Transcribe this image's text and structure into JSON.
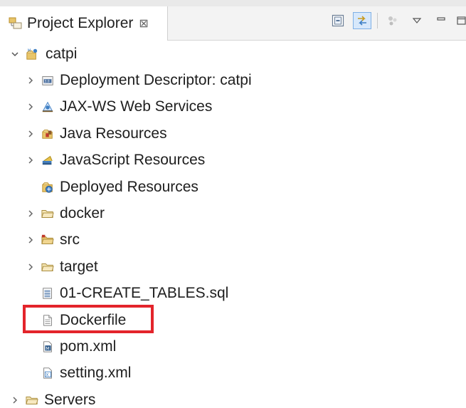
{
  "view": {
    "title": "Project Explorer",
    "close_glyph": "⊠"
  },
  "toolbar": {
    "buttons": [
      {
        "name": "collapse-all-icon"
      },
      {
        "name": "link-with-editor-icon"
      },
      {
        "name": "focus-icon"
      },
      {
        "name": "view-menu-icon"
      },
      {
        "name": "minimize-icon"
      },
      {
        "name": "maximize-icon"
      }
    ]
  },
  "tree": {
    "items": [
      {
        "label": "catpi",
        "icon": "web-project-icon",
        "expanded": true
      },
      {
        "label": "Deployment Descriptor: catpi",
        "icon": "deployment-descriptor-icon"
      },
      {
        "label": "JAX-WS Web Services",
        "icon": "web-services-icon"
      },
      {
        "label": "Java Resources",
        "icon": "java-resources-icon"
      },
      {
        "label": "JavaScript Resources",
        "icon": "javascript-resources-icon"
      },
      {
        "label": "Deployed Resources",
        "icon": "deployed-resources-icon"
      },
      {
        "label": "docker",
        "icon": "folder-icon"
      },
      {
        "label": "src",
        "icon": "source-folder-icon"
      },
      {
        "label": "target",
        "icon": "folder-icon"
      },
      {
        "label": "01-CREATE_TABLES.sql",
        "icon": "sql-file-icon"
      },
      {
        "label": "Dockerfile",
        "icon": "text-file-icon",
        "highlighted": true
      },
      {
        "label": "pom.xml",
        "icon": "maven-pom-icon"
      },
      {
        "label": "setting.xml",
        "icon": "xml-file-icon"
      },
      {
        "label": "Servers",
        "icon": "folder-icon"
      }
    ]
  },
  "colors": {
    "highlight_border": "#e3242b",
    "folder": "#e8c56a",
    "accent_blue": "#3f7fc4"
  }
}
